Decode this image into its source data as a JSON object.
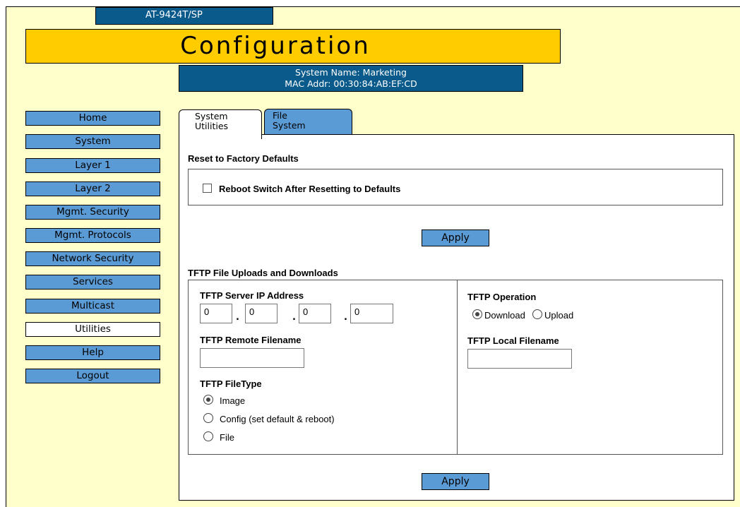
{
  "header": {
    "model": "AT-9424T/SP",
    "title": "Configuration",
    "system_name": "System Name: Marketing",
    "mac_addr": "MAC Addr: 00:30:84:AB:EF:CD"
  },
  "nav": {
    "items": [
      {
        "label": "Home"
      },
      {
        "label": "System"
      },
      {
        "label": "Layer 1"
      },
      {
        "label": "Layer 2"
      },
      {
        "label": "Mgmt. Security"
      },
      {
        "label": "Mgmt. Protocols"
      },
      {
        "label": "Network Security"
      },
      {
        "label": "Services"
      },
      {
        "label": "Multicast"
      },
      {
        "label": "Utilities",
        "active": true
      },
      {
        "label": "Help"
      },
      {
        "label": "Logout"
      }
    ]
  },
  "tabs": {
    "system_utilities": {
      "line1": "System",
      "line2": "Utilities"
    },
    "file_system": {
      "line1": "File",
      "line2": "System"
    }
  },
  "reset": {
    "heading": "Reset to Factory Defaults",
    "reboot_label": "Reboot Switch After Resetting to Defaults",
    "reboot_checked": false,
    "apply_label": "Apply"
  },
  "tftp": {
    "heading": "TFTP File Uploads and Downloads",
    "server_ip_label": "TFTP Server IP Address",
    "ip_octets": [
      "0",
      "0",
      "0",
      "0"
    ],
    "ip_separator": ".",
    "remote_filename_label": "TFTP Remote Filename",
    "remote_filename_value": "",
    "filetype_label": "TFTP FileType",
    "filetypes": [
      {
        "label": "Image",
        "selected": true
      },
      {
        "label": "Config (set default & reboot)",
        "selected": false
      },
      {
        "label": "File",
        "selected": false
      }
    ],
    "operation_label": "TFTP Operation",
    "operations": [
      {
        "label": "Download",
        "selected": true
      },
      {
        "label": "Upload",
        "selected": false
      }
    ],
    "local_filename_label": "TFTP Local Filename",
    "local_filename_value": "",
    "apply_label": "Apply"
  },
  "colors": {
    "background": "#ffffcc",
    "header_blue": "#0a5a8c",
    "title_yellow": "#ffcc00",
    "button_blue": "#5b9bd5"
  }
}
